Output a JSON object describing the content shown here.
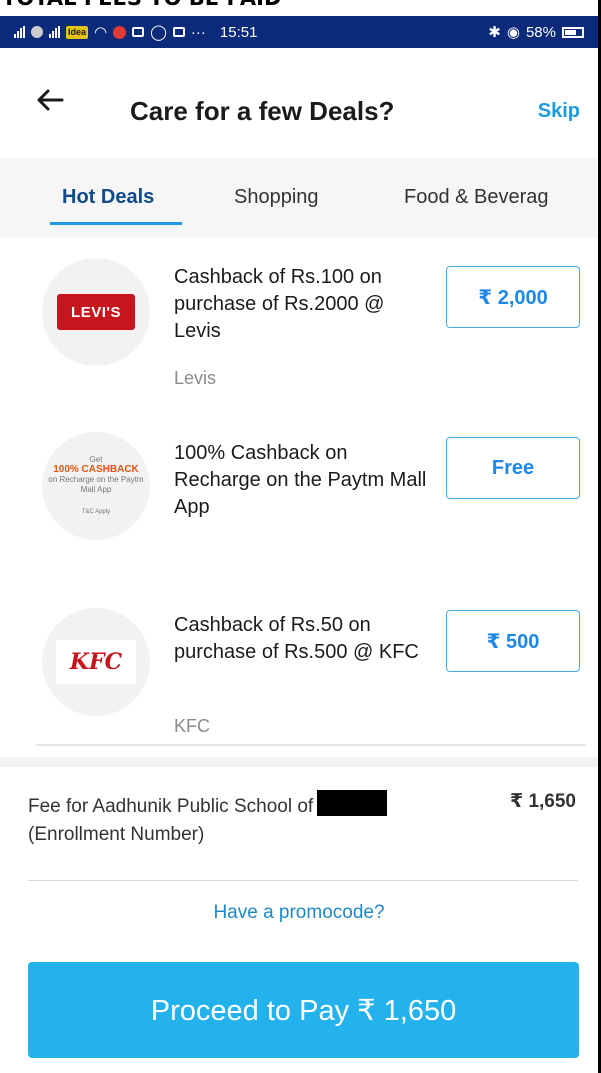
{
  "doc_heading": "TOTAL FEES TO BE PAID",
  "status_bar": {
    "carrier_badge": "Idea",
    "time": "15:51",
    "battery": "58%"
  },
  "header": {
    "title": "Care for a few Deals?",
    "skip_label": "Skip"
  },
  "tabs": [
    {
      "label": "Hot Deals",
      "active": true
    },
    {
      "label": "Shopping",
      "active": false
    },
    {
      "label": "Food & Beverag",
      "active": false
    }
  ],
  "deals": [
    {
      "logo_text": "LEVI'S",
      "title": "Cashback of Rs.100 on purchase of Rs.2000 @ Levis",
      "brand": "Levis",
      "price": "₹ 2,000"
    },
    {
      "logo_text": "100% CASHBACK",
      "logo_sub_top": "Get",
      "logo_sub_bottom": "on Recharge on the Paytm Mall App",
      "logo_fine": "T&C Apply",
      "title": "100% Cashback on Recharge on the Paytm Mall App",
      "brand": "",
      "price": "Free"
    },
    {
      "logo_text": "KFC",
      "title": "Cashback of Rs.50 on purchase of Rs.500 @ KFC",
      "brand": "KFC",
      "price": "₹ 500"
    }
  ],
  "fee": {
    "label": "Fee for Aadhunik Public School of",
    "label_suffix": "(Enrollment Number)",
    "amount": "₹ 1,650"
  },
  "promo_label": "Have a promocode?",
  "pay_button_label": "Proceed to Pay ₹ 1,650",
  "colors": {
    "accent": "#1e9be0",
    "pay_button": "#24b2ec",
    "status_bar": "#0b2a7a"
  }
}
